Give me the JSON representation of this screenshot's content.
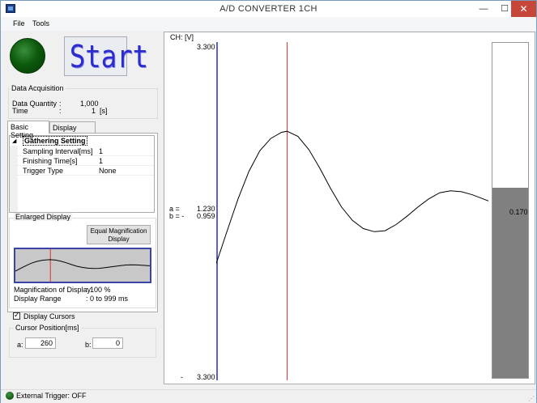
{
  "window": {
    "title": "A/D CONVERTER 1CH",
    "min_glyph": "—",
    "max_glyph": "☐",
    "close_glyph": "✕"
  },
  "menu": {
    "file": "File",
    "tools": "Tools"
  },
  "start_label": "Start",
  "acquisition": {
    "title": "Data Acquisition",
    "quantity_label": "Data Quantity",
    "quantity_value": "1,000",
    "time_label": "Time",
    "time_value": "1",
    "time_unit": "[s]",
    "colon": ":"
  },
  "tabs": {
    "basic": "Basic Setting",
    "display": "Display Setting"
  },
  "gathering": {
    "category": "Gathering Setting",
    "rows": [
      {
        "name": "Sampling Interval[ms]",
        "value": "1"
      },
      {
        "name": "Finishing Time[s]",
        "value": "1"
      },
      {
        "name": "Trigger Type",
        "value": "None"
      }
    ]
  },
  "enlarged": {
    "title": "Enlarged Display",
    "equal_button": "Equal Magnification Display",
    "magnification_label": "Magnification of Display",
    "magnification_value": ": 100 %",
    "range_label": "Display Range",
    "range_value": ": 0 to 999 ms"
  },
  "cursors": {
    "display_label": "Display Cursors",
    "checked": true,
    "position_title": "Cursor Position[ms]",
    "a_label": "a:",
    "a_value": "260",
    "b_label": "b:",
    "b_value": "0"
  },
  "status": {
    "text": "External Trigger: OFF"
  },
  "chart_data": {
    "type": "line",
    "channel_label": "CH: [V]",
    "y_top_label": "3.300",
    "y_bottom_label": "3.300",
    "bottom_dash": "-",
    "cursor_a_label": "a =",
    "cursor_a_value": "1.230",
    "cursor_b_label": "b = -",
    "cursor_b_value": "0.959",
    "ylim": [
      0,
      3.3
    ],
    "xlim": [
      0,
      999
    ],
    "cursor_a_ms": 260,
    "cursor_b_ms": 0,
    "colors": {
      "cursor_a": "#e03030",
      "cursor_b": "#2030c0",
      "trace": "#000000",
      "bar": "#808080"
    },
    "series": [
      {
        "x": [
          0,
          40,
          80,
          120,
          160,
          200,
          240,
          260,
          300,
          340,
          380,
          420,
          460,
          500,
          540,
          580,
          620,
          660,
          700,
          740,
          780,
          820,
          860,
          900,
          940,
          980,
          999
        ],
        "y": [
          1.14,
          1.46,
          1.77,
          2.04,
          2.24,
          2.36,
          2.42,
          2.43,
          2.38,
          2.25,
          2.07,
          1.87,
          1.69,
          1.56,
          1.48,
          1.45,
          1.46,
          1.52,
          1.6,
          1.69,
          1.77,
          1.83,
          1.85,
          1.84,
          1.81,
          1.77,
          1.75
        ]
      }
    ],
    "bar_value": 0.17,
    "bar_label": "0.170",
    "bar_ylim": [
      0,
      0.3
    ]
  }
}
